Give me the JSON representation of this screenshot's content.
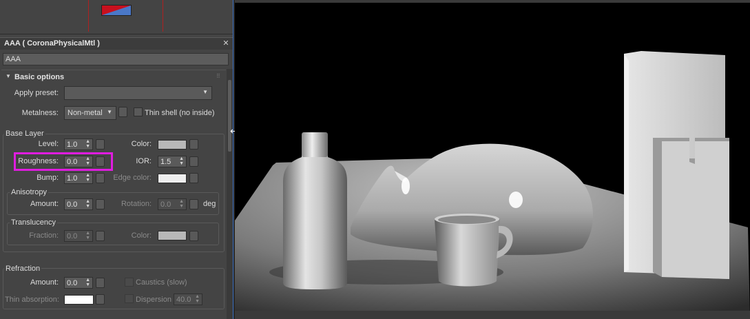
{
  "material": {
    "title": "AAA  ( CoronaPhysicalMtl )",
    "name": "AAA"
  },
  "basic_options": {
    "rollout_title": "Basic options",
    "apply_preset_label": "Apply preset:",
    "apply_preset_value": "",
    "metalness_label": "Metalness:",
    "metalness_value": "Non-metal",
    "thin_shell_label": "Thin shell (no inside)"
  },
  "base_layer": {
    "title": "Base Layer",
    "level_label": "Level:",
    "level_value": "1.0",
    "color_label": "Color:",
    "color_hex": "#b8b8b8",
    "roughness_label": "Roughness:",
    "roughness_value": "0.0",
    "ior_label": "IOR:",
    "ior_value": "1.5",
    "bump_label": "Bump:",
    "bump_value": "1.0",
    "edge_color_label": "Edge color:",
    "edge_color_hex": "#eeeeee"
  },
  "anisotropy": {
    "title": "Anisotropy",
    "amount_label": "Amount:",
    "amount_value": "0.0",
    "rotation_label": "Rotation:",
    "rotation_value": "0.0",
    "rotation_unit": "deg"
  },
  "translucency": {
    "title": "Translucency",
    "fraction_label": "Fraction:",
    "fraction_value": "0.0",
    "color_label": "Color:",
    "color_hex": "#b8b8b8"
  },
  "refraction": {
    "title": "Refraction",
    "amount_label": "Amount:",
    "amount_value": "0.0",
    "caustics_label": "Caustics (slow)",
    "thin_absorption_label": "Thin absorption:",
    "thin_absorption_hex": "#ffffff",
    "dispersion_label": "Dispersion",
    "dispersion_value": "40.0"
  },
  "colors": {
    "highlight": "#e01ce0",
    "panel_bg": "#444444",
    "viewport_bg": "#000000"
  }
}
